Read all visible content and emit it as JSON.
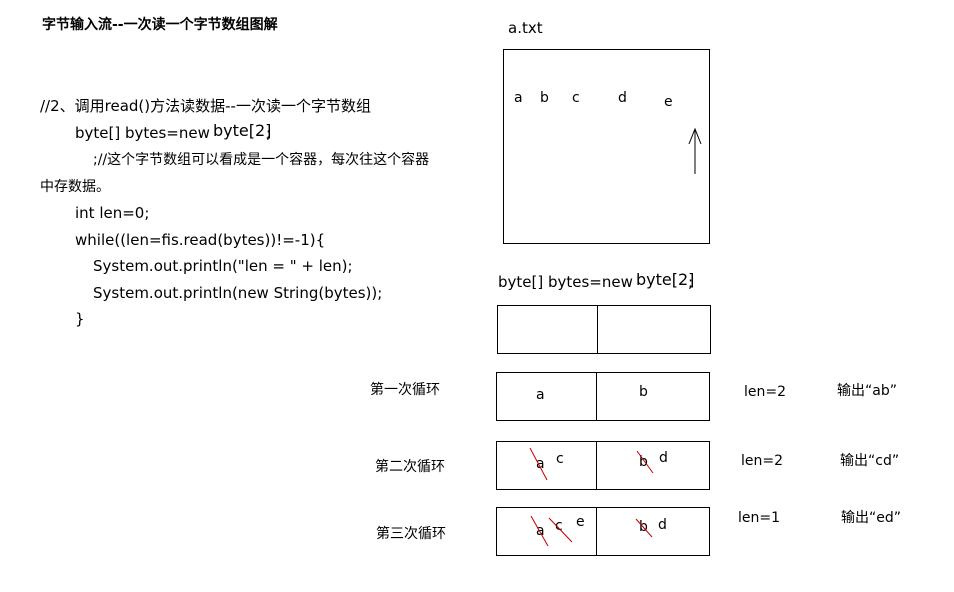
{
  "title": "字节输入流--一次读一个字节数组图解",
  "code": {
    "comment": "//2、调用read()方法读数据--一次读一个字节数组",
    "decl_part1": "byte[] bytes=new",
    "decl_part2": "byte[2]",
    "decl_semicolon": ";",
    "note_line1": ";//这个字节数组可以看成是一个容器，每次往这个容器",
    "note_line2": "中存数据。",
    "len_init": "int len=0;",
    "while_line": "while((len=fis.read(bytes))!=-1){",
    "println_len": "System.out.println(\"len = \" + len);",
    "println_str": "System.out.println(new String(bytes));",
    "close_brace": "}"
  },
  "file": {
    "name": "a.txt",
    "chars": [
      "a",
      "b",
      "c",
      "d",
      "e"
    ]
  },
  "array": {
    "decl_part1": "byte[] bytes=new",
    "decl_part2": "byte[2]",
    "decl_semicolon": ";"
  },
  "loops": [
    {
      "label": "第一次循环",
      "cell1": {
        "current": "a",
        "previous": []
      },
      "cell2": {
        "current": "b",
        "previous": []
      },
      "len": "len=2",
      "output": "输出“ab”"
    },
    {
      "label": "第二次循环",
      "cell1": {
        "current": "c",
        "previous": [
          "a"
        ]
      },
      "cell2": {
        "current": "d",
        "previous": [
          "b"
        ]
      },
      "len": "len=2",
      "output": "输出“cd”"
    },
    {
      "label": "第三次循环",
      "cell1": {
        "current": "e",
        "previous": [
          "a",
          "c"
        ]
      },
      "cell2": {
        "current": "d",
        "previous": [
          "b"
        ]
      },
      "len": "len=1",
      "output": "输出“ed”"
    }
  ],
  "colors": {
    "text": "#000000",
    "strike": "#c00000",
    "border": "#000000"
  },
  "icons": {
    "pointer": "up-arrow-icon"
  }
}
